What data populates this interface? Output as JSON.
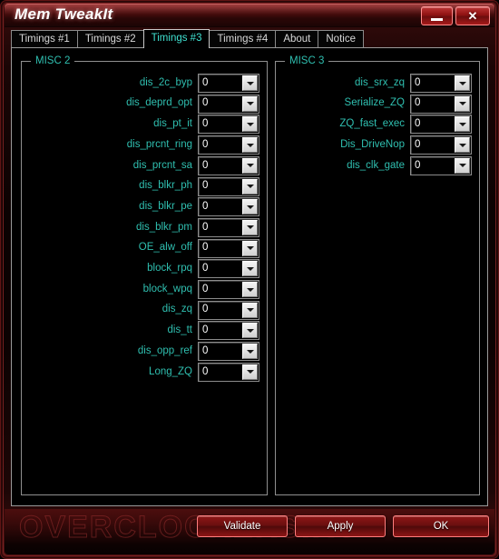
{
  "window": {
    "title": "Mem TweakIt",
    "minimize_label": "minimize",
    "close_label": "✕"
  },
  "tabs": [
    {
      "label": "Timings #1",
      "active": false
    },
    {
      "label": "Timings #2",
      "active": false
    },
    {
      "label": "Timings #3",
      "active": true
    },
    {
      "label": "Timings #4",
      "active": false
    },
    {
      "label": "About",
      "active": false
    },
    {
      "label": "Notice",
      "active": false
    }
  ],
  "groups": {
    "misc2": {
      "title": "MISC 2",
      "rows": [
        {
          "label": "dis_2c_byp",
          "value": "0"
        },
        {
          "label": "dis_deprd_opt",
          "value": "0"
        },
        {
          "label": "dis_pt_it",
          "value": "0"
        },
        {
          "label": "dis_prcnt_ring",
          "value": "0"
        },
        {
          "label": "dis_prcnt_sa",
          "value": "0"
        },
        {
          "label": "dis_blkr_ph",
          "value": "0"
        },
        {
          "label": "dis_blkr_pe",
          "value": "0"
        },
        {
          "label": "dis_blkr_pm",
          "value": "0"
        },
        {
          "label": "OE_alw_off",
          "value": "0"
        },
        {
          "label": "block_rpq",
          "value": "0"
        },
        {
          "label": "block_wpq",
          "value": "0"
        },
        {
          "label": "dis_zq",
          "value": "0"
        },
        {
          "label": "dis_tt",
          "value": "0"
        },
        {
          "label": "dis_opp_ref",
          "value": "0"
        },
        {
          "label": "Long_ZQ",
          "value": "0"
        }
      ]
    },
    "misc3": {
      "title": "MISC 3",
      "rows": [
        {
          "label": "dis_srx_zq",
          "value": "0"
        },
        {
          "label": "Serialize_ZQ",
          "value": "0"
        },
        {
          "label": "ZQ_fast_exec",
          "value": "0"
        },
        {
          "label": "Dis_DriveNop",
          "value": "0"
        },
        {
          "label": "dis_clk_gate",
          "value": "0"
        }
      ]
    }
  },
  "footer": {
    "watermark": "OVERCLOCKERS.RU",
    "buttons": [
      {
        "label": "Validate"
      },
      {
        "label": "Apply"
      },
      {
        "label": "OK"
      }
    ]
  },
  "colors": {
    "accent_teal": "#2fbfb0",
    "active_tab_text": "#3fe0d0",
    "brand_red": "#8e1c1c",
    "panel_border": "#9a9a9a",
    "background": "#000000"
  }
}
